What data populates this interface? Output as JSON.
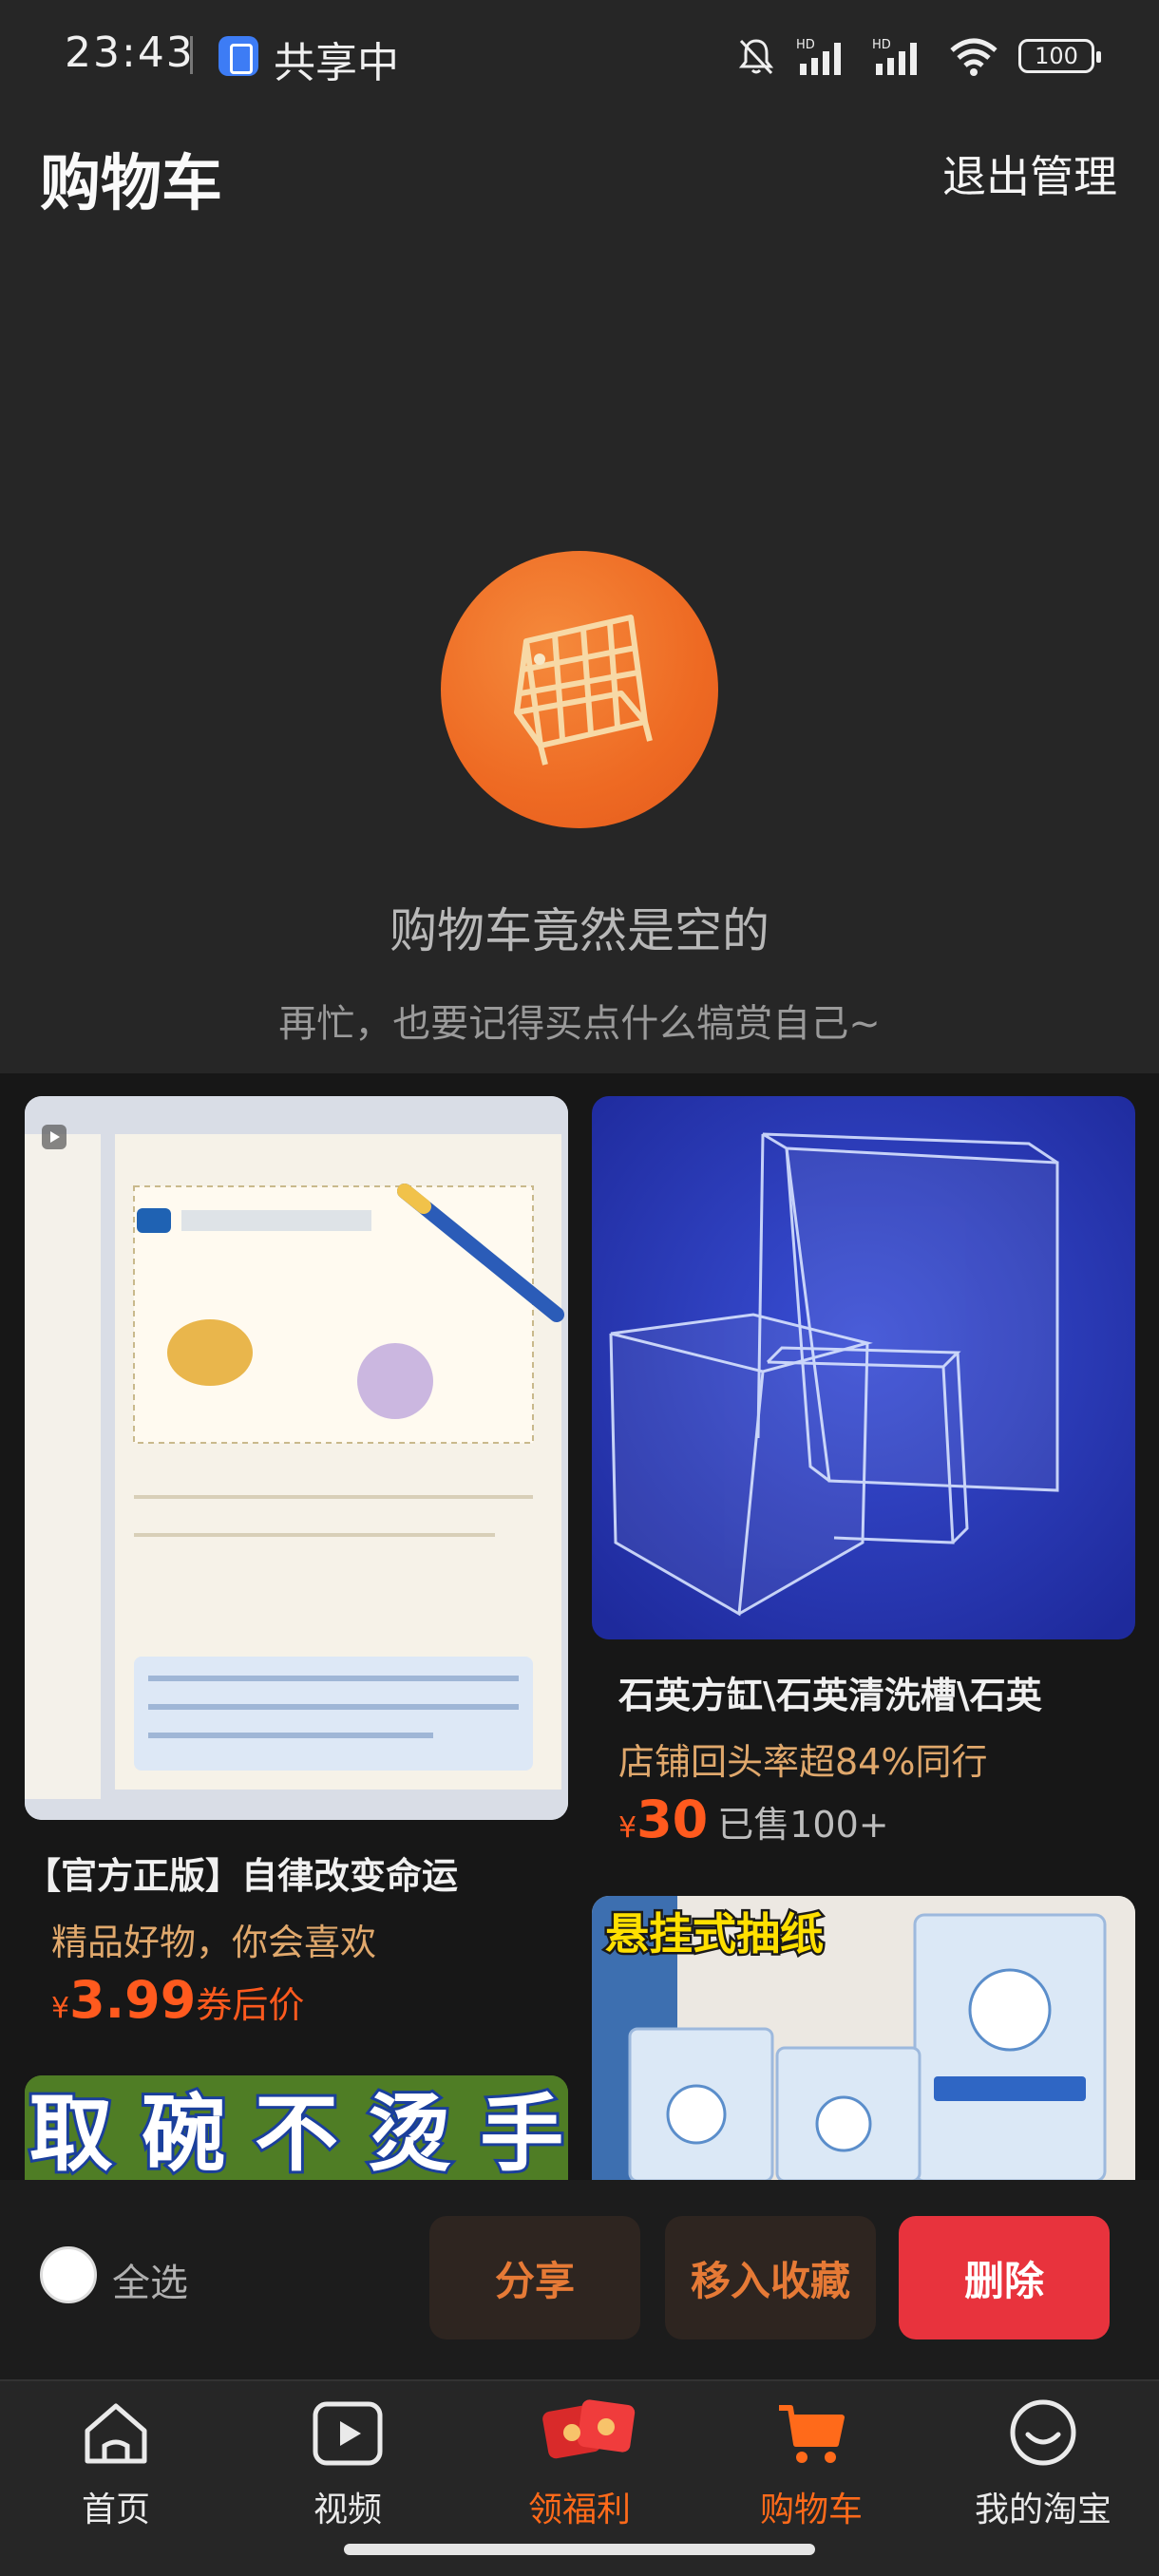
{
  "status_bar": {
    "time": "23:43",
    "sharing": "共享中",
    "battery": "100"
  },
  "header": {
    "title": "购物车",
    "exit_manage": "退出管理"
  },
  "empty_state": {
    "icon": "empty-cart-icon",
    "title": "购物车竟然是空的",
    "subtitle": "再忙，也要记得买点什么犒赏自己~"
  },
  "products": [
    {
      "title": "【官方正版】自律改变命运",
      "tag": "精品好物，你会喜欢",
      "price_symbol": "¥",
      "price": "3.99",
      "price_suffix": "券后价",
      "sold": ""
    },
    {
      "title": "石英方缸\\石英清洗槽\\石英",
      "tag": "店铺回头率超84%同行",
      "price_symbol": "¥",
      "price": "30",
      "price_suffix": "",
      "sold": "已售100+"
    }
  ],
  "banners": {
    "bowl": "取 碗 不 烫 手",
    "tissue": "悬挂式抽纸"
  },
  "action_bar": {
    "select_all": "全选",
    "share": "分享",
    "favorite": "移入收藏",
    "delete": "删除"
  },
  "tab_bar": {
    "items": [
      {
        "label": "首页",
        "icon": "home-icon"
      },
      {
        "label": "视频",
        "icon": "video-icon"
      },
      {
        "label": "领福利",
        "icon": "red-envelope-icon"
      },
      {
        "label": "购物车",
        "icon": "cart-icon",
        "active": true
      },
      {
        "label": "我的淘宝",
        "icon": "smile-icon"
      }
    ]
  },
  "colors": {
    "accent": "#ff6a1a",
    "delete": "#e8333d",
    "background": "#262626"
  }
}
